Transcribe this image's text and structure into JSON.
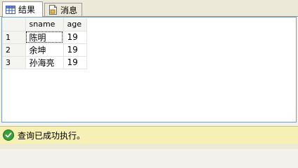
{
  "tabs": [
    {
      "label": "结果",
      "icon": "grid-icon",
      "active": true
    },
    {
      "label": "消息",
      "icon": "message-document-icon",
      "active": false
    }
  ],
  "grid": {
    "columns": [
      "sname",
      "age"
    ],
    "rows": [
      {
        "num": "1",
        "sname": "陈明",
        "age": "19"
      },
      {
        "num": "2",
        "sname": "余坤",
        "age": "19"
      },
      {
        "num": "3",
        "sname": "孙海亮",
        "age": "19"
      }
    ]
  },
  "status": {
    "icon": "success-check-icon",
    "text": "查询已成功执行。",
    "color": "#f6f0b4"
  }
}
